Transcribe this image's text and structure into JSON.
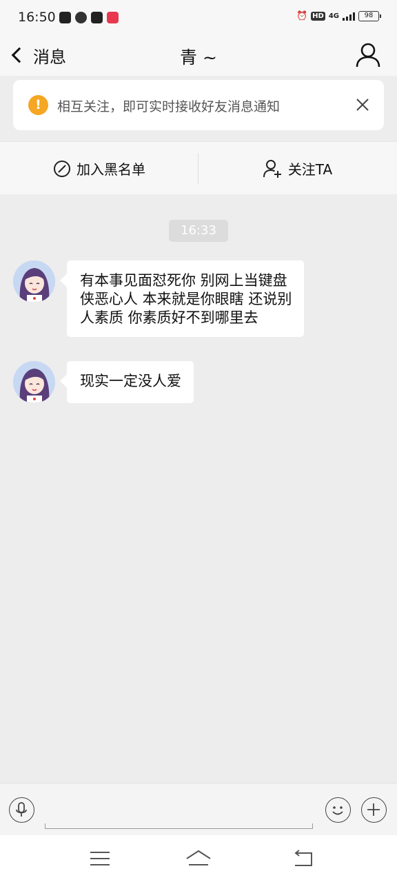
{
  "status_bar": {
    "time": "16:50",
    "network": "4G",
    "hd": "HD",
    "battery": "98",
    "icons": [
      "tiktok-icon",
      "compass-icon",
      "video-icon",
      "news-app-icon",
      "alarm-icon"
    ]
  },
  "header": {
    "back_label": "消息",
    "title": "青 ~"
  },
  "notice": {
    "icon": "!",
    "text": "相互关注，即可实时接收好友消息通知"
  },
  "actions": {
    "blacklist_label": "加入黑名单",
    "follow_label": "关注TA"
  },
  "chat": {
    "timestamp": "16:33",
    "messages": [
      {
        "sender": "other",
        "lines": [
          "有本事见面怼死你 别网上当键盘",
          "侠恶心人 本来就是你眼瞎 还说别",
          "人素质 你素质好不到哪里去"
        ]
      },
      {
        "sender": "other",
        "lines": [
          "现实一定没人爱"
        ]
      }
    ]
  },
  "colors": {
    "accent_warning": "#f5a623",
    "background": "#ededed",
    "bubble": "#ffffff"
  }
}
